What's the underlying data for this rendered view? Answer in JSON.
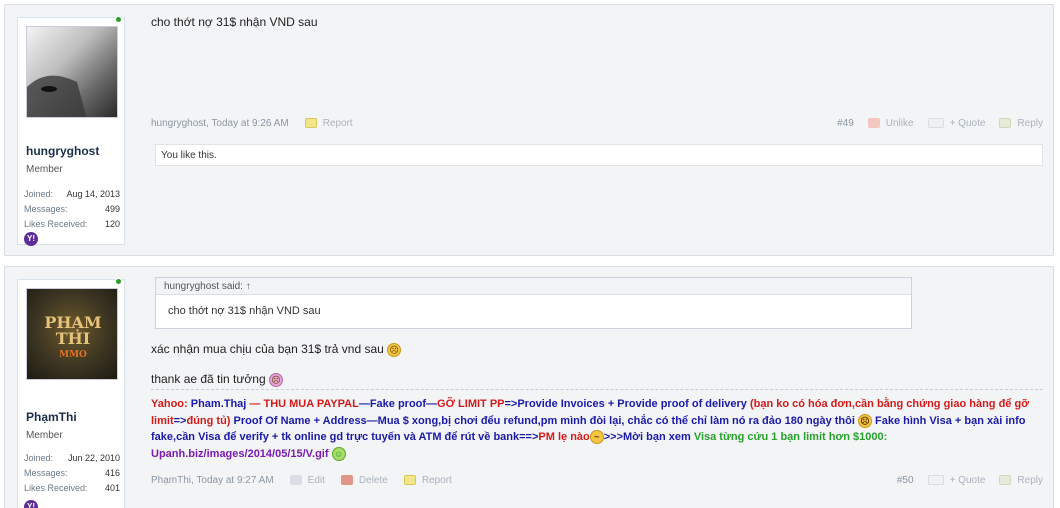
{
  "posts": [
    {
      "username": "hungryghost",
      "usertitle": "Member",
      "joined_label": "Joined:",
      "joined": "Aug 14, 2013",
      "messages_label": "Messages:",
      "messages": "499",
      "likes_label": "Likes Received:",
      "likes": "120",
      "message": "cho thớt nợ 31$ nhận VND sau",
      "meta_author": "hungryghost, Today at 9:26 AM",
      "report_label": "Report",
      "number": "#49",
      "unlike_label": "Unlike",
      "quote_label": "+ Quote",
      "reply_label": "Reply",
      "likes_text": "You like this."
    },
    {
      "username": "PhạmThi",
      "usertitle": "Member",
      "joined_label": "Joined:",
      "joined": "Jun 22, 2010",
      "messages_label": "Messages:",
      "messages": "416",
      "likes_label": "Likes Received:",
      "likes": "401",
      "quote_author": "hungryghost said: ↑",
      "quote_text": "cho thớt nợ 31$ nhận VND sau",
      "message_line1": "xác nhận mua chịu của bạn 31$ trả vnd sau",
      "message_line2": "thank ae đã tin tưởng",
      "meta_author": "PhạmThi, Today at 9:27 AM",
      "edit_label": "Edit",
      "delete_label": "Delete",
      "report_label": "Report",
      "number": "#50",
      "quote_label": "+ Quote",
      "reply_label": "Reply",
      "avatar_text_1": "PHẠM",
      "avatar_text_2": "THI",
      "avatar_text_3": "MMO"
    }
  ],
  "signature": {
    "s1": "Yahoo: ",
    "s2": "Pham.Thaj",
    "s3": " — THU MUA PAYPAL",
    "s4": "—Fake proof—",
    "s5": "GỠ LIMIT PP",
    "s6": "=>Provide Invoices + Provide proof of delivery ",
    "s7": "(bạn ko có hóa đơn,cần bằng chứng giao hàng để gỡ limit",
    "s8": "=>",
    "s9": "đúng tủ)",
    "s10": " Proof Of Name + Address—Mua $ xong,bị chơi đểu refund,pm mình đòi lại, chắc có thể chỉ làm nó ra đảo 180 ngày thôi ",
    "s11": " Fake hình Visa + bạn xài info fake,cần Visa để verify + tk online gd trực tuyến và ATM để rút về bank==>",
    "s12": "PM lẹ nào",
    "s13": ">>>Mời bạn xem ",
    "s14": "Visa từng cứu 1 bạn limit hơn $1000:",
    "s15": " Upanh.biz/images/2014/05/15/V.gif"
  },
  "icons": {
    "yahoo_icon": "Y!",
    "smiley": "☹"
  },
  "colors": {
    "accent_red": "#d11b1b",
    "accent_blue": "#1a1aa6",
    "accent_green": "#27a12b",
    "accent_purple": "#7a1ab0",
    "online": "#2b9e28"
  }
}
